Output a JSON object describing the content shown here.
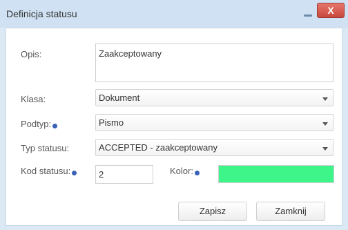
{
  "window": {
    "title": "Definicja statusu",
    "close_glyph": "X"
  },
  "form": {
    "opis_label": "Opis:",
    "opis_value": "Zaakceptowany",
    "klasa_label": "Klasa:",
    "klasa_value": "Dokument",
    "podtyp_label": "Podtyp:",
    "podtyp_value": "Pismo",
    "typ_label": "Typ statusu:",
    "typ_value": "ACCEPTED - zaakceptowany",
    "kod_label": "Kod statusu:",
    "kod_value": "2",
    "kolor_label": "Kolor:",
    "kolor_value": "#3ef58a"
  },
  "buttons": {
    "save_label": "Zapisz",
    "close_label": "Zamknij"
  },
  "icons": [
    "minimize-icon",
    "close-icon",
    "info-icon",
    "dropdown-caret-icon"
  ],
  "colors": {
    "titlebar": "#cfe1f2",
    "close_button": "#d9584c",
    "info_icon": "#3a62b4",
    "status_color": "#3ef58a"
  }
}
